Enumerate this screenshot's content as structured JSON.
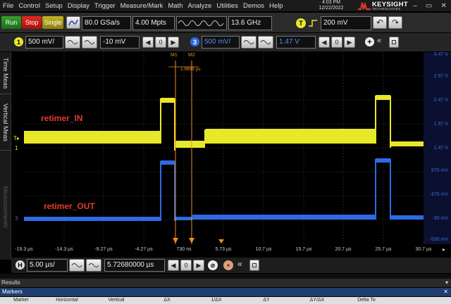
{
  "menu": [
    "File",
    "Control",
    "Setup",
    "Display",
    "Trigger",
    "Measure/Mark",
    "Math",
    "Analyze",
    "Utilities",
    "Demos",
    "Help"
  ],
  "clock": {
    "time": "4:03 PM",
    "date": "12/22/2022"
  },
  "brand": {
    "name": "KEYSIGHT",
    "tagline": "TECHNOLOGIES"
  },
  "toolbar": {
    "run": "Run",
    "stop": "Stop",
    "single": "Single",
    "sample_rate": "80.0 GSa/s",
    "memory_depth": "4.00 Mpts",
    "bandwidth": "13.6 GHz",
    "trigger_label": "T",
    "trigger_level": "200 mV"
  },
  "channels": {
    "ch1": {
      "id": "1",
      "scale": "500 mV/",
      "offset": "-10 mV",
      "color": "#e8e82a"
    },
    "ch3": {
      "id": "3",
      "scale": "500 mV/",
      "offset": "1.47 V",
      "color": "#2d6be6"
    }
  },
  "side_tabs": [
    "Time Meas",
    "Vertical Meas",
    "Measurements"
  ],
  "waveforms": {
    "ch1_label": "retimer_IN",
    "ch3_label": "retimer_OUT"
  },
  "markers": {
    "m1": "M1",
    "m2": "M2",
    "delta": "1.9889 µs"
  },
  "y_scale_ch3": [
    "3.47 V",
    "2.97 V",
    "2.47 V",
    "1.97 V",
    "1.47 V",
    "970 mV",
    "470 mV",
    "-30 mV",
    "-530 mV"
  ],
  "x_scale": [
    "-19.3 µs",
    "-14.3 µs",
    "-9.27 µs",
    "-4.27 µs",
    "730 ns",
    "5.73 µs",
    "10.7 µs",
    "15.7 µs",
    "20.7 µs",
    "25.7 µs",
    "30.7 µs"
  ],
  "horizontal": {
    "id": "H",
    "scale": "5.00 µs/",
    "position": "5.72680000 µs"
  },
  "results": {
    "title": "Results",
    "tab": "Markers",
    "columns": [
      "Marker",
      "Horizontal",
      "Vertical",
      "ΔX",
      "1/ΔX",
      "ΔY",
      "ΔY/ΔX",
      "Delta To"
    ]
  }
}
